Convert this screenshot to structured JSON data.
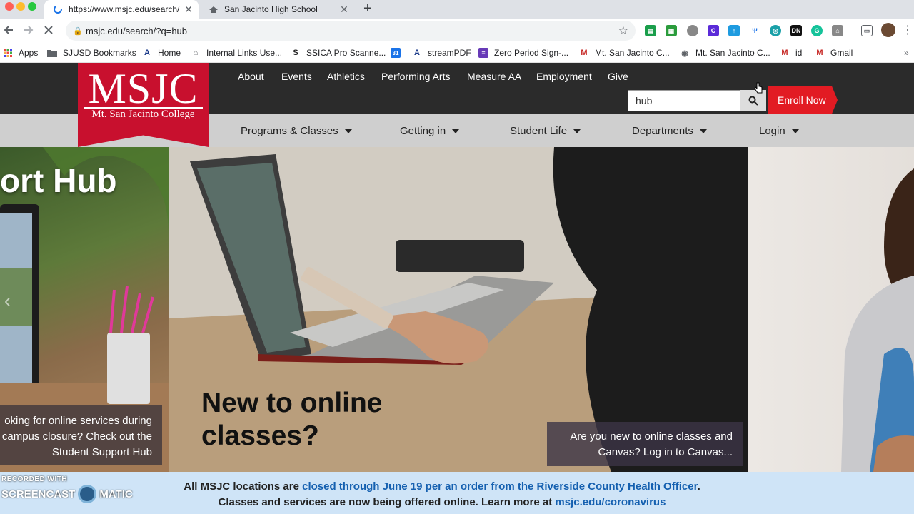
{
  "browser": {
    "tabs": [
      {
        "title": "https://www.msjc.edu/search/",
        "active": true
      },
      {
        "title": "San Jacinto High School",
        "active": false
      }
    ],
    "url": "msjc.edu/search/?q=hub",
    "bookmarks": [
      {
        "label": "Apps",
        "icon": "apps-grid-icon"
      },
      {
        "label": "SJUSD Bookmarks",
        "icon": "folder-icon"
      },
      {
        "label": "Home",
        "icon": "a-logo-icon"
      },
      {
        "label": "Internal Links Use...",
        "icon": "school-icon"
      },
      {
        "label": "SSICA Pro Scanne...",
        "icon": "s-logo-icon"
      },
      {
        "label": "streamPDF",
        "icon": "calendar-icon"
      },
      {
        "label": "Zero Period Sign-...",
        "icon": "forms-icon"
      },
      {
        "label": "Mt. San Jacinto C...",
        "icon": "gmail-icon"
      },
      {
        "label": "Mt. San Jacinto C...",
        "icon": "globe-icon"
      },
      {
        "label": "id",
        "icon": "gmail-icon"
      },
      {
        "label": "Gmail",
        "icon": "gmail-icon"
      }
    ]
  },
  "site": {
    "logo": {
      "text": "MSJC",
      "subtitle": "Mt. San Jacinto College",
      "color": "#c8102e"
    },
    "top_links": [
      "About",
      "Events",
      "Athletics",
      "Performing Arts",
      "Measure AA",
      "Employment",
      "Give"
    ],
    "search_value": "hub",
    "enroll_label": "Enroll Now",
    "main_nav": [
      "Programs & Classes",
      "Getting in",
      "Student Life",
      "Departments",
      "Login"
    ],
    "hero": {
      "left_title": "ort Hub",
      "left_caption": [
        "oking for online services during",
        "campus closure? Check out the",
        "Student Support Hub"
      ],
      "main_title": [
        "New to online",
        "classes?"
      ],
      "main_caption": [
        "Are you new to online classes and",
        "Canvas?  Log in to Canvas..."
      ]
    },
    "alert": {
      "line1_prefix": "All MSJC locations are ",
      "line1_link": "closed through June 19 per an order from the Riverside County Health Officer",
      "line1_suffix": ".",
      "line2_prefix": "Classes and services are now being offered online. Learn more at ",
      "line2_link": "msjc.edu/coronavirus"
    }
  },
  "watermark": {
    "line1": "RECORDED WITH",
    "line2a": "SCREENCAST",
    "line2b": "MATIC"
  }
}
